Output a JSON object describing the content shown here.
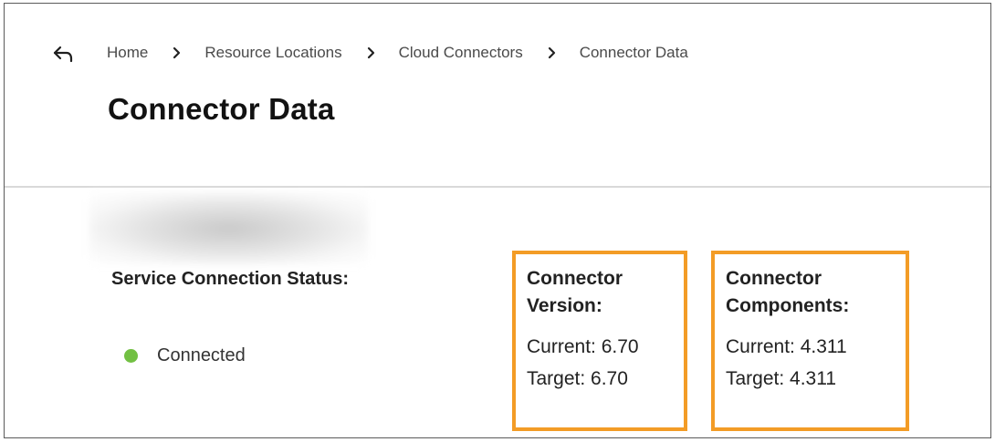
{
  "breadcrumb": {
    "back_icon": "back-arrow-icon",
    "separator_icon": "chevron-right-icon",
    "items": [
      {
        "label": "Home"
      },
      {
        "label": "Resource Locations"
      },
      {
        "label": "Cloud Connectors"
      },
      {
        "label": "Connector Data"
      }
    ]
  },
  "page": {
    "title": "Connector Data"
  },
  "status": {
    "label": "Service Connection Status:",
    "value": "Connected",
    "color": "#72c043"
  },
  "connector_version": {
    "title_line1": "Connector",
    "title_line2": "Version:",
    "current": "Current: 6.70",
    "target": "Target: 6.70"
  },
  "connector_components": {
    "title_line1": "Connector",
    "title_line2": "Components:",
    "current": "Current: 4.311",
    "target": "Target: 4.311"
  },
  "colors": {
    "highlight_border": "#f39c26",
    "divider": "#d9d9d9"
  }
}
